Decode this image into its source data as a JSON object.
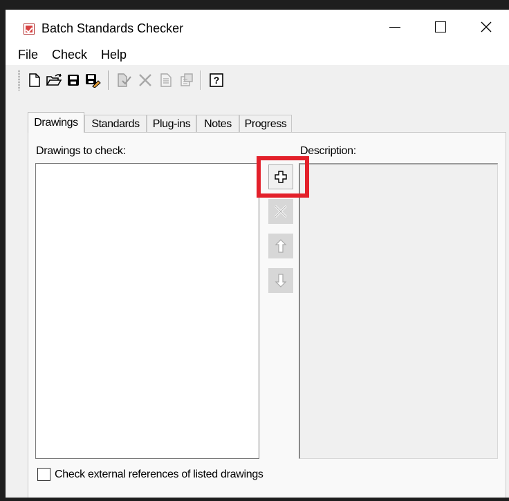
{
  "window": {
    "title": "Batch Standards Checker",
    "controls": {
      "minimize": "minimize",
      "maximize": "maximize",
      "close": "close"
    }
  },
  "menu": [
    "File",
    "Check",
    "Help"
  ],
  "toolbar": {
    "buttons": [
      {
        "icon": "new-icon",
        "enabled": true
      },
      {
        "icon": "open-folder-icon",
        "enabled": true
      },
      {
        "icon": "save-icon",
        "enabled": true
      },
      {
        "icon": "save-as-icon",
        "enabled": true
      },
      {
        "icon": "check-icon",
        "enabled": false
      },
      {
        "icon": "delete-icon",
        "enabled": false
      },
      {
        "icon": "report-icon",
        "enabled": false
      },
      {
        "icon": "export-icon",
        "enabled": false
      },
      {
        "icon": "help-icon",
        "enabled": true
      }
    ]
  },
  "tabs": [
    {
      "label": "Drawings",
      "active": true
    },
    {
      "label": "Standards",
      "active": false
    },
    {
      "label": "Plug-ins",
      "active": false
    },
    {
      "label": "Notes",
      "active": false
    },
    {
      "label": "Progress",
      "active": false
    }
  ],
  "drawings_panel": {
    "list_label": "Drawings to check:",
    "description_label": "Description:",
    "items": []
  },
  "side_buttons": [
    {
      "icon": "add-plus-icon",
      "enabled": true,
      "highlighted": true
    },
    {
      "icon": "remove-x-icon",
      "enabled": false
    },
    {
      "icon": "move-up-icon",
      "enabled": false
    },
    {
      "icon": "move-down-icon",
      "enabled": false
    }
  ],
  "options": {
    "check_xrefs_label": "Check external references of listed drawings",
    "check_xrefs_checked": false
  },
  "colors": {
    "highlight": "#e3202a",
    "title_bar": "#ffffff",
    "panel_bg": "#f0f0f0"
  }
}
